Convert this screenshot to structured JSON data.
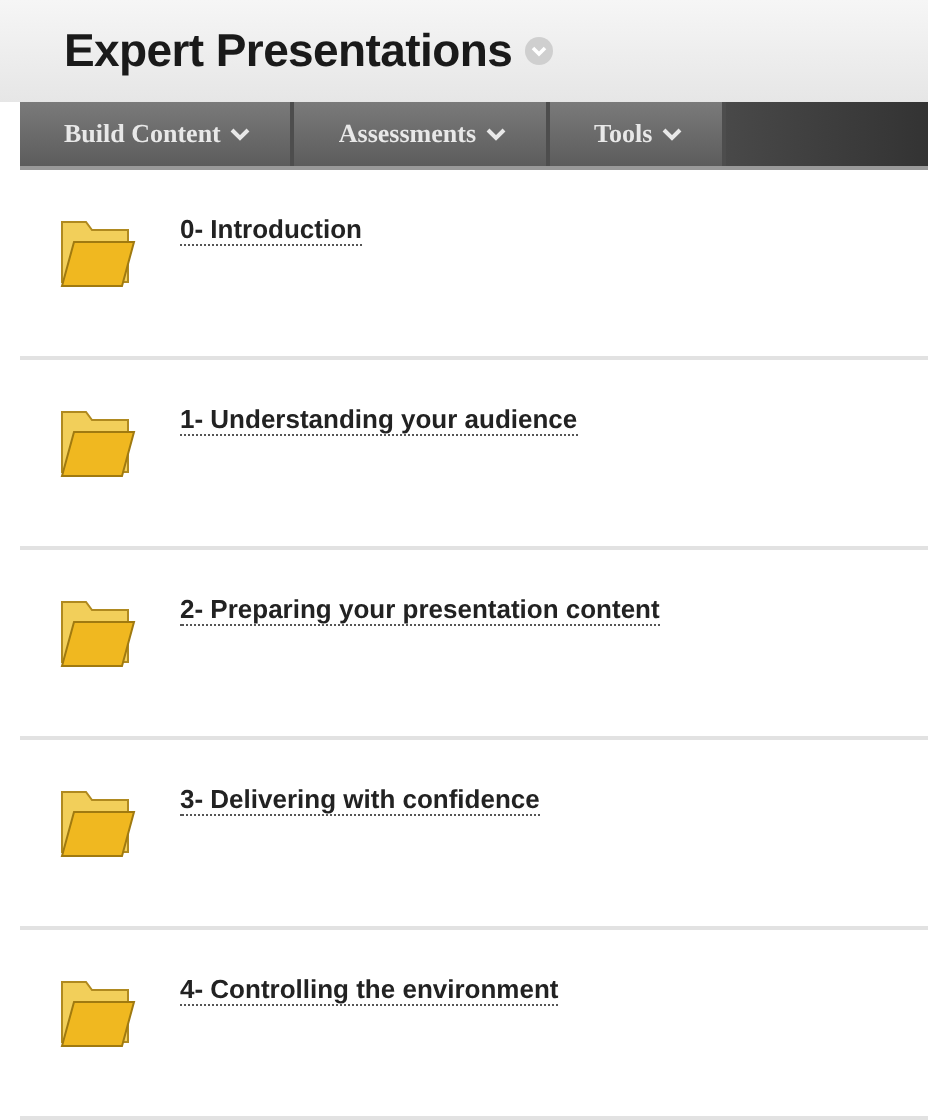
{
  "page_title": "Expert Presentations",
  "menu": [
    {
      "label": "Build Content"
    },
    {
      "label": "Assessments"
    },
    {
      "label": "Tools"
    }
  ],
  "folders": [
    {
      "title": "0- Introduction"
    },
    {
      "title": "1- Understanding your audience"
    },
    {
      "title": "2- Preparing your presentation content"
    },
    {
      "title": "3- Delivering with confidence"
    },
    {
      "title": "4- Controlling the environment"
    }
  ]
}
